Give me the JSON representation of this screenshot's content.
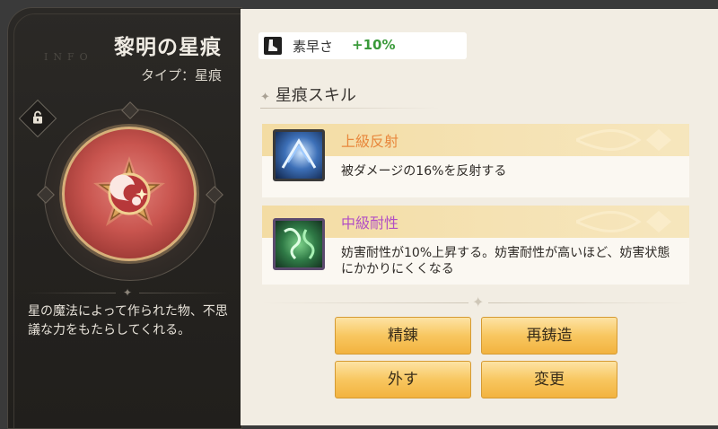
{
  "item": {
    "title": "黎明の星痕",
    "watermark": "INFO",
    "type": "タイプ：星痕",
    "description": "星の魔法によって作られた物、不思議な力をもたらしてくれる。"
  },
  "stat": {
    "icon": "boot-icon",
    "label": "素早さ",
    "value": "+10%"
  },
  "skills_section": {
    "title": "星痕スキル",
    "skills": [
      {
        "name": "上級反射",
        "name_color": "#e8873c",
        "description": "被ダメージの16%を反射する",
        "icon": "reflect-skill-icon"
      },
      {
        "name": "中級耐性",
        "name_color": "#b24fc4",
        "description": "妨害耐性が10%上昇する。妨害耐性が高いほど、妨害状態にかかりにくくなる",
        "icon": "resistance-skill-icon"
      }
    ]
  },
  "buttons": {
    "refine": "精錬",
    "reforge": "再鋳造",
    "remove": "外す",
    "change": "変更"
  }
}
